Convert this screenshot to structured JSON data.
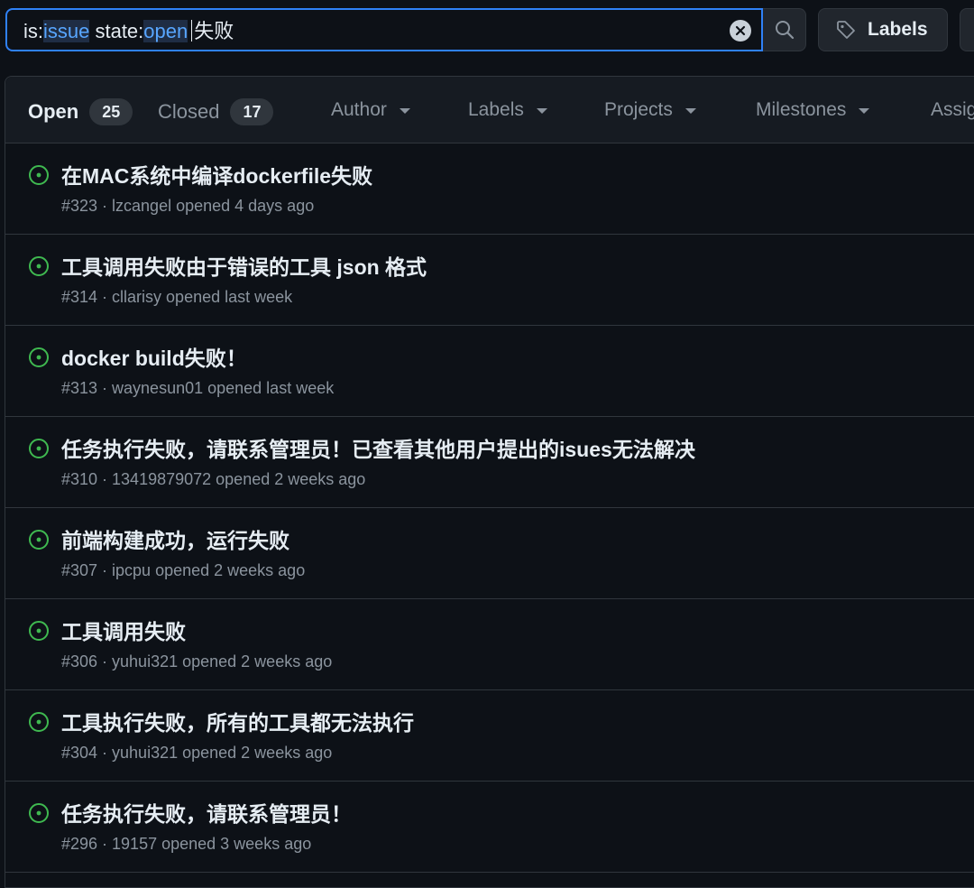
{
  "search": {
    "key1": "is:",
    "val1": "issue",
    "key2": " state:",
    "val2": "open",
    "free_text": "失败"
  },
  "toolbar": {
    "labels_button": "Labels"
  },
  "tabs": {
    "open_label": "Open",
    "open_count": "25",
    "closed_label": "Closed",
    "closed_count": "17"
  },
  "filters": [
    "Author",
    "Labels",
    "Projects",
    "Milestones",
    "Assig"
  ],
  "issues": [
    {
      "title": "在MAC系统中编译dockerfile失败",
      "meta": "#323 · lzcangel opened 4 days ago"
    },
    {
      "title": "工具调用失败由于错误的工具 json 格式",
      "meta": "#314 · cllarisy opened last week"
    },
    {
      "title": "docker build失败！",
      "meta": "#313 · waynesun01 opened last week"
    },
    {
      "title": "任务执行失败，请联系管理员！已查看其他用户提出的isues无法解决",
      "meta": "#310 · 13419879072 opened 2 weeks ago"
    },
    {
      "title": "前端构建成功，运行失败",
      "meta": "#307 · ipcpu opened 2 weeks ago"
    },
    {
      "title": "工具调用失败",
      "meta": "#306 · yuhui321 opened 2 weeks ago"
    },
    {
      "title": "工具执行失败，所有的工具都无法执行",
      "meta": "#304 · yuhui321 opened 2 weeks ago"
    },
    {
      "title": "任务执行失败，请联系管理员！",
      "meta": "#296 · 19157 opened 3 weeks ago"
    }
  ],
  "colors": {
    "accent": "#2f81f7",
    "open_icon": "#3fb950",
    "background": "#0d1117",
    "muted_text": "#8b949e"
  },
  "icons": {
    "clear": "x-circle-fill-icon",
    "search": "search-icon",
    "labels": "tag-icon",
    "issue_state": "issue-opened-icon"
  }
}
